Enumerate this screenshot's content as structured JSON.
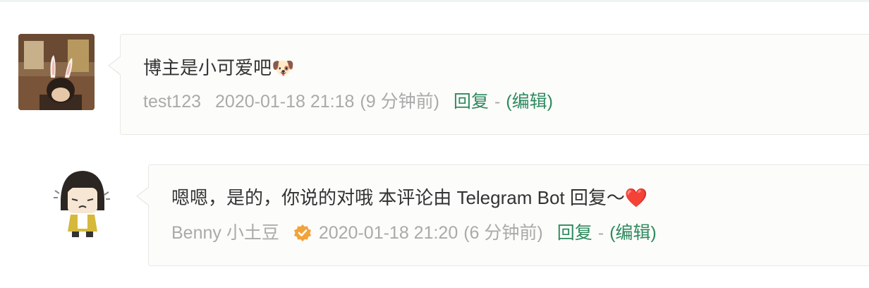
{
  "comments": [
    {
      "text": "博主是小可爱吧🐶",
      "author": "test123",
      "date": "2020-01-18 21:18",
      "relative": "(9 分钟前)",
      "reply_label": "回复",
      "separator": "-",
      "edit_label": "(编辑)"
    },
    {
      "text": "嗯嗯，是的，你说的对哦 本评论由 Telegram Bot 回复～❤️",
      "author": "Benny 小土豆",
      "verified_icon": "verified-badge-icon",
      "verified_color": "#f2a33a",
      "date": "2020-01-18 21:20",
      "relative": "(6 分钟前)",
      "reply_label": "回复",
      "separator": "-",
      "edit_label": "(编辑)"
    }
  ]
}
